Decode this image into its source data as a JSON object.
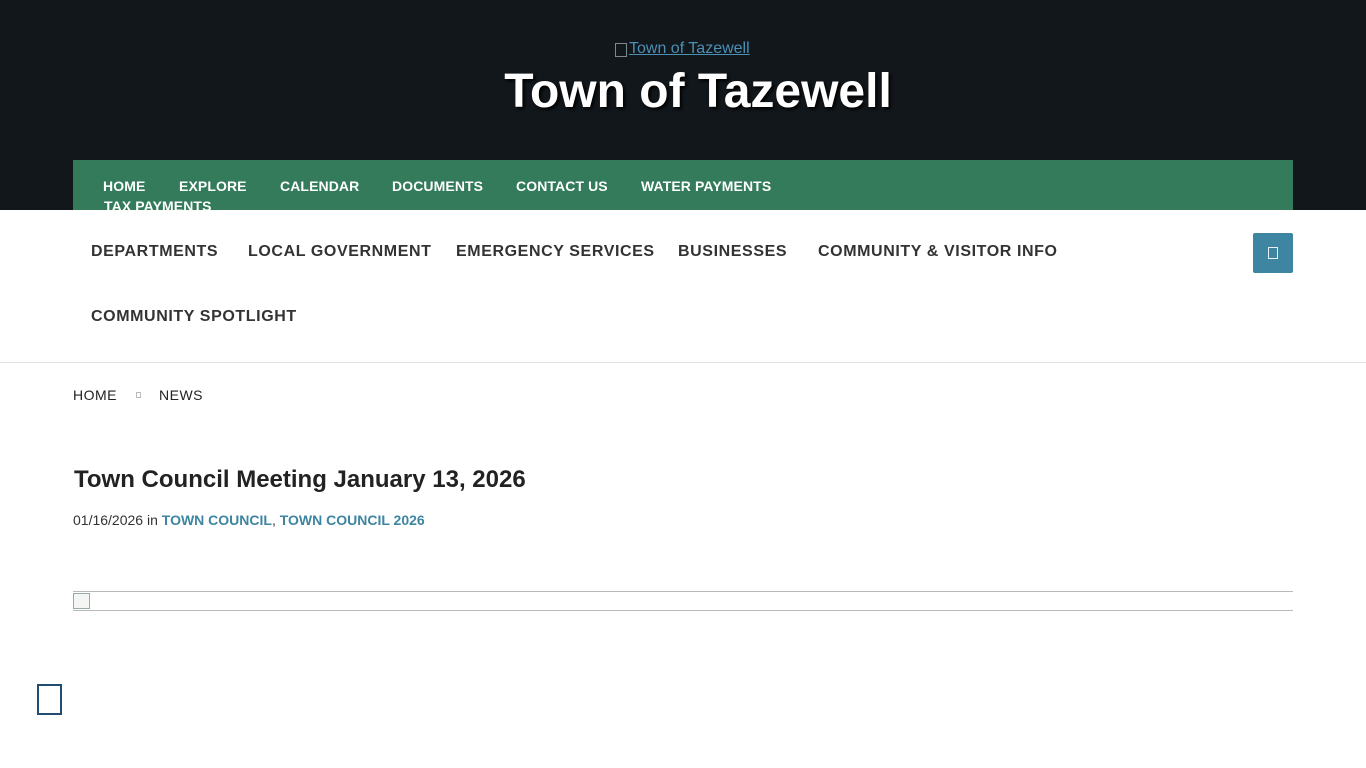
{
  "header": {
    "logo_alt": "Town of Tazewell",
    "site_title": "Town of Tazewell"
  },
  "top_nav": {
    "items": [
      {
        "label": "HOME"
      },
      {
        "label": "EXPLORE"
      },
      {
        "label": "CALENDAR"
      },
      {
        "label": "DOCUMENTS"
      },
      {
        "label": "CONTACT US"
      },
      {
        "label": "WATER PAYMENTS"
      },
      {
        "label": "TAX PAYMENTS"
      }
    ]
  },
  "main_nav": {
    "items": [
      {
        "label": "DEPARTMENTS"
      },
      {
        "label": "LOCAL GOVERNMENT"
      },
      {
        "label": "EMERGENCY SERVICES"
      },
      {
        "label": "BUSINESSES"
      },
      {
        "label": "COMMUNITY & VISITOR INFO"
      },
      {
        "label": "COMMUNITY SPOTLIGHT"
      }
    ],
    "search_icon": "search-icon"
  },
  "breadcrumb": {
    "home": "HOME",
    "current": "NEWS"
  },
  "post": {
    "title": "Town Council Meeting January 13, 2026",
    "date": "01/16/2026",
    "in_label": "in",
    "categories": [
      "TOWN COUNCIL",
      "TOWN COUNCIL 2026"
    ],
    "category_separator": ","
  },
  "accessibility": {
    "icon": "accessibility-icon"
  },
  "colors": {
    "header_bg": "#12171b",
    "top_nav_bg": "#337b5b",
    "accent": "#3d85a0"
  }
}
